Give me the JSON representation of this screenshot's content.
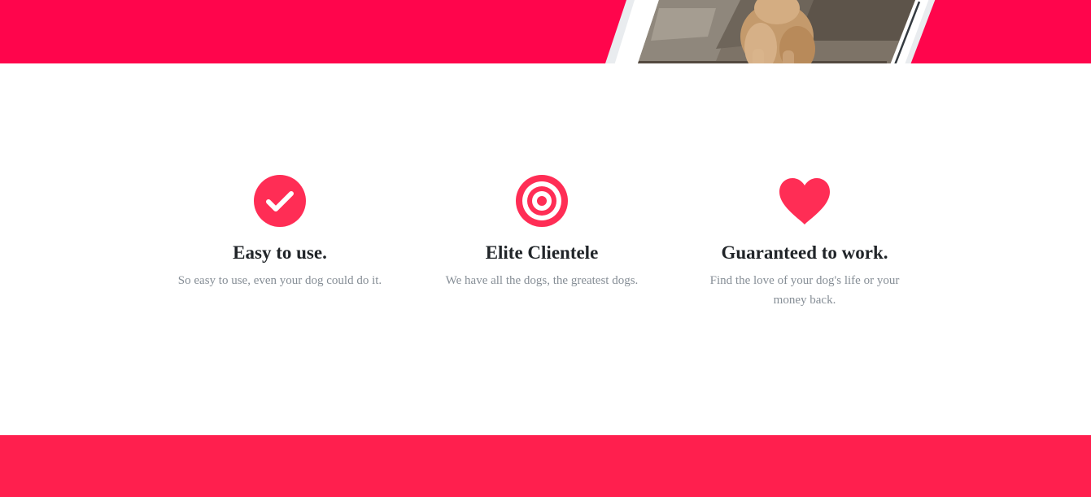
{
  "colors": {
    "top_band": "#ff054c",
    "bottom_band": "#ff1f4e",
    "accent": "#ff2d55",
    "title_text": "#212529",
    "body_text": "#868e96"
  },
  "hero": {
    "image": "dog-in-phone-frame"
  },
  "features": [
    {
      "icon": "check-circle-icon",
      "title": "Easy to use.",
      "description": "So easy to use, even your dog could do it."
    },
    {
      "icon": "target-icon",
      "title": "Elite Clientele",
      "description": "We have all the dogs, the greatest dogs."
    },
    {
      "icon": "heart-icon",
      "title": "Guaranteed to work.",
      "description": "Find the love of your dog's life or your money back."
    }
  ]
}
